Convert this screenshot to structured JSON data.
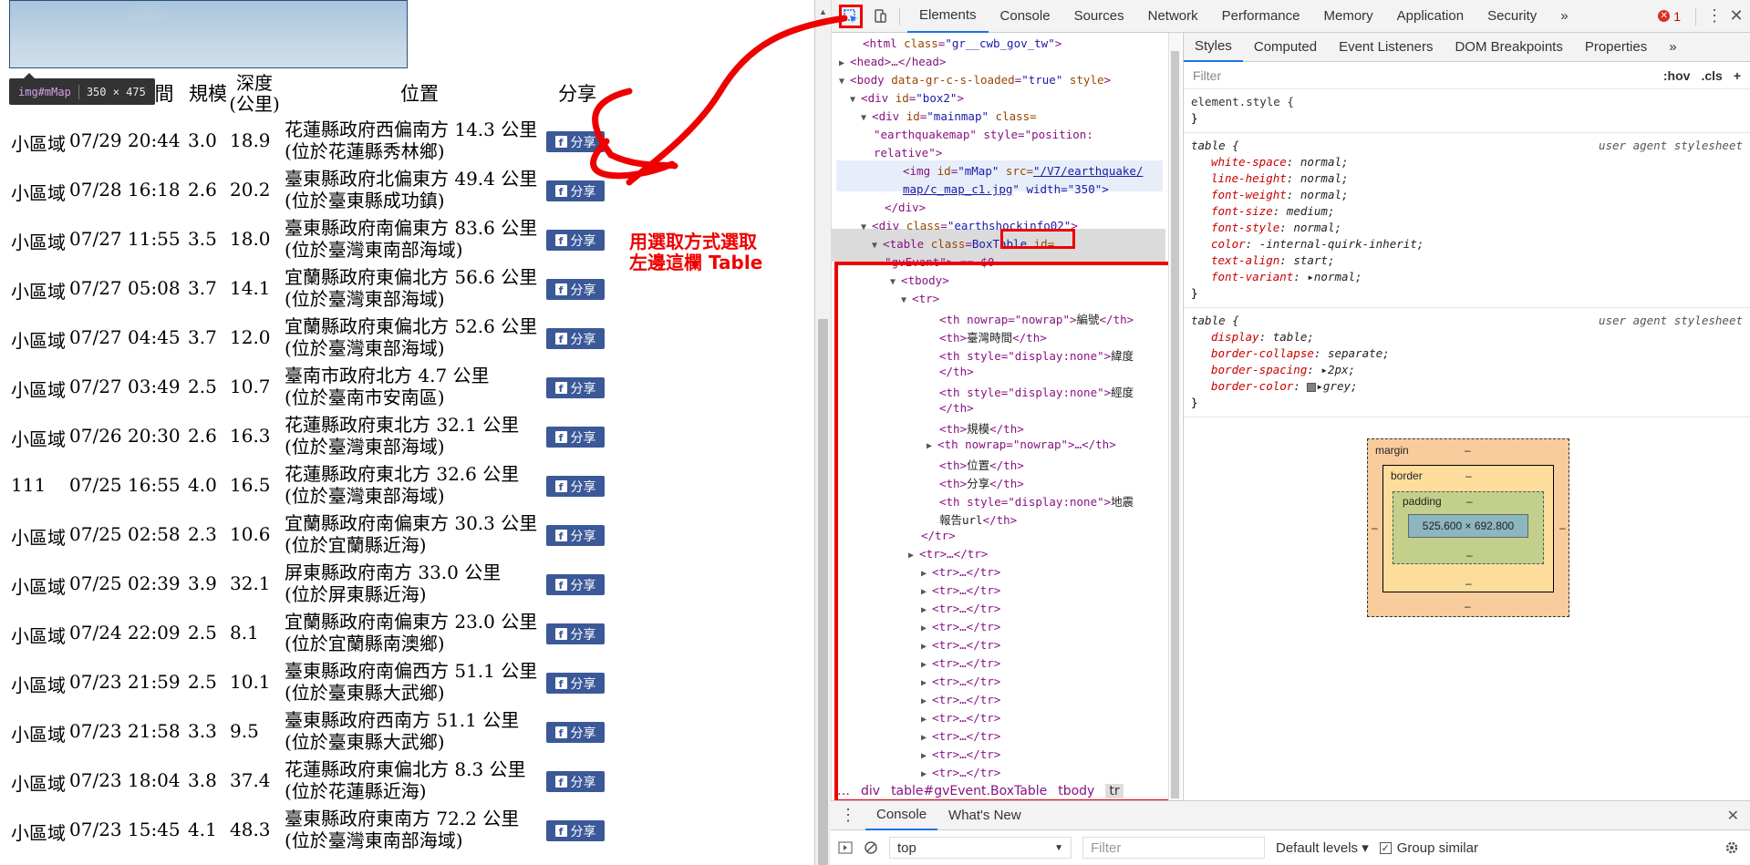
{
  "page": {
    "tooltip": {
      "tag": "img",
      "id": "#mMap",
      "size": "350 × 475"
    },
    "headers": {
      "time": "間",
      "magnitude": "規模",
      "depth_line1": "深度",
      "depth_line2": "(公里)",
      "location": "位置",
      "share": "分享"
    },
    "share_label": "分享",
    "fb_glyph": "f",
    "rows": [
      {
        "area": "小區域",
        "time": "07/29 20:44",
        "mag": "3.0",
        "depth": "18.9",
        "loc1": "花蓮縣政府西偏南方 14.3 公里",
        "loc2": "(位於花蓮縣秀林鄉)"
      },
      {
        "area": "小區域",
        "time": "07/28 16:18",
        "mag": "2.6",
        "depth": "20.2",
        "loc1": "臺東縣政府北偏東方 49.4 公里",
        "loc2": "(位於臺東縣成功鎮)"
      },
      {
        "area": "小區域",
        "time": "07/27 11:55",
        "mag": "3.5",
        "depth": "18.0",
        "loc1": "臺東縣政府南偏東方 83.6 公里",
        "loc2": "(位於臺灣東南部海域)"
      },
      {
        "area": "小區域",
        "time": "07/27 05:08",
        "mag": "3.7",
        "depth": "14.1",
        "loc1": "宜蘭縣政府東偏北方 56.6 公里",
        "loc2": "(位於臺灣東部海域)"
      },
      {
        "area": "小區域",
        "time": "07/27 04:45",
        "mag": "3.7",
        "depth": "12.0",
        "loc1": "宜蘭縣政府東偏北方 52.6 公里",
        "loc2": "(位於臺灣東部海域)"
      },
      {
        "area": "小區域",
        "time": "07/27 03:49",
        "mag": "2.5",
        "depth": "10.7",
        "loc1": "臺南市政府北方 4.7 公里",
        "loc2": "(位於臺南市安南區)"
      },
      {
        "area": "小區域",
        "time": "07/26 20:30",
        "mag": "2.6",
        "depth": "16.3",
        "loc1": "花蓮縣政府東北方 32.1 公里",
        "loc2": "(位於臺灣東部海域)"
      },
      {
        "area": "111",
        "time": "07/25 16:55",
        "mag": "4.0",
        "depth": "16.5",
        "loc1": "花蓮縣政府東北方 32.6 公里",
        "loc2": "(位於臺灣東部海域)"
      },
      {
        "area": "小區域",
        "time": "07/25 02:58",
        "mag": "2.3",
        "depth": "10.6",
        "loc1": "宜蘭縣政府南偏東方 30.3 公里",
        "loc2": "(位於宜蘭縣近海)"
      },
      {
        "area": "小區域",
        "time": "07/25 02:39",
        "mag": "3.9",
        "depth": "32.1",
        "loc1": "屏東縣政府南方 33.0 公里",
        "loc2": "(位於屏東縣近海)"
      },
      {
        "area": "小區域",
        "time": "07/24 22:09",
        "mag": "2.5",
        "depth": "8.1",
        "loc1": "宜蘭縣政府南偏東方 23.0 公里",
        "loc2": "(位於宜蘭縣南澳鄉)"
      },
      {
        "area": "小區域",
        "time": "07/23 21:59",
        "mag": "2.5",
        "depth": "10.1",
        "loc1": "臺東縣政府南偏西方 51.1 公里",
        "loc2": "(位於臺東縣大武鄉)"
      },
      {
        "area": "小區域",
        "time": "07/23 21:58",
        "mag": "3.3",
        "depth": "9.5",
        "loc1": "臺東縣政府西南方 51.1 公里",
        "loc2": "(位於臺東縣大武鄉)"
      },
      {
        "area": "小區域",
        "time": "07/23 18:04",
        "mag": "3.8",
        "depth": "37.4",
        "loc1": "花蓮縣政府東偏北方 8.3 公里",
        "loc2": "(位於花蓮縣近海)"
      },
      {
        "area": "小區域",
        "time": "07/23 15:45",
        "mag": "4.1",
        "depth": "48.3",
        "loc1": "臺東縣政府東南方 72.2 公里",
        "loc2": "(位於臺灣東南部海域)"
      }
    ],
    "annotation": {
      "line1": "用選取方式選取",
      "line2": "左邊這欄 Table"
    }
  },
  "devtools": {
    "tabs": [
      "Elements",
      "Console",
      "Sources",
      "Network",
      "Performance",
      "Memory",
      "Application",
      "Security"
    ],
    "more_tabs": "»",
    "error_count": "1",
    "kebab": "⋮",
    "close": "✕",
    "tree": [
      {
        "text_tag": "<html ",
        "a": "class",
        "v": "\"gr__cwb_gov_tw\"",
        "end": ">"
      },
      {
        "text": "<head>…</head>"
      },
      {
        "text_tag": "<body ",
        "a": "data-gr-c-s-loaded",
        "v": "\"true\"",
        "a2": " style",
        "end": ">"
      },
      {
        "text_tag": "<div ",
        "a": "id",
        "v": "\"box2\"",
        "end": ">"
      },
      {
        "text_tag": "<div ",
        "a": "id",
        "v": "\"mainmap\"",
        "a2": " class=",
        "end": ""
      },
      {
        "text": "\"earthquakemap\" style=\"position:"
      },
      {
        "text": "relative\">"
      },
      {
        "text_tag": "<img ",
        "a": "id",
        "v": "\"mMap\"",
        "a2": " src=",
        "link": "\"/V7/earthquake/"
      },
      {
        "link": "map/c_map_c1.jpg",
        "tail": "\" width=\"350\">"
      },
      {
        "text": "</div>"
      },
      {
        "text_tag": "<div ",
        "a": "class",
        "v": "\"earthshockinfo02\"",
        "end": ">"
      },
      {
        "text_tag": "<table ",
        "a": "class",
        "v": "BoxTable",
        "a2": " id=",
        "end": ""
      },
      {
        "text": "\"gvEvent\"> == $0"
      },
      {
        "text": "<tbody>"
      },
      {
        "text": "<tr>"
      },
      {
        "th": "<th nowrap=\"nowrap\">",
        "t": "編號",
        "c": "</th>"
      },
      {
        "th": "<th>",
        "t": "臺灣時間",
        "c": "</th>"
      },
      {
        "th": "<th style=\"display:none\">",
        "t": "緯度",
        "c": ""
      },
      {
        "text": "</th>"
      },
      {
        "th": "<th style=\"display:none\">",
        "t": "經度",
        "c": ""
      },
      {
        "text": "</th>"
      },
      {
        "th": "<th>",
        "t": "規模",
        "c": "</th>"
      },
      {
        "text": "<th nowrap=\"nowrap\">…</th>"
      },
      {
        "th": "<th>",
        "t": "位置",
        "c": "</th>"
      },
      {
        "th": "<th>",
        "t": "分享",
        "c": "</th>"
      },
      {
        "th": "<th style=\"display:none\">",
        "t": "地震",
        "c": ""
      },
      {
        "th": "",
        "t": "報告url",
        "c": "</th>"
      },
      {
        "text": "</tr>"
      },
      {
        "text": "<tr>…</tr>"
      }
    ],
    "collapsed_tr": "<tr>…</tr>",
    "crumbs": [
      "…",
      "div",
      "table#gvEvent.BoxTable",
      "tbody",
      "tr"
    ],
    "styles_tabs": [
      "Styles",
      "Computed",
      "Event Listeners",
      "DOM Breakpoints",
      "Properties",
      "»"
    ],
    "filter_placeholder": "Filter",
    "hov": ":hov",
    "cls": ".cls",
    "plus": "+",
    "rule_element": {
      "selector": "element.style {",
      "close": "}"
    },
    "rule_table1": {
      "selector": "table {",
      "source": "user agent stylesheet",
      "props": [
        [
          "white-space",
          "normal;"
        ],
        [
          "line-height",
          "normal;"
        ],
        [
          "font-weight",
          "normal;"
        ],
        [
          "font-size",
          "medium;"
        ],
        [
          "font-style",
          "normal;"
        ],
        [
          "color",
          "-internal-quirk-inherit;"
        ],
        [
          "text-align",
          "start;"
        ],
        [
          "font-variant",
          "▸normal;"
        ]
      ]
    },
    "rule_table2": {
      "selector": "table {",
      "source": "user agent stylesheet",
      "props": [
        [
          "display",
          "table;"
        ],
        [
          "border-collapse",
          "separate;"
        ],
        [
          "border-spacing",
          "▸2px;"
        ],
        [
          "border-color",
          "▸grey;"
        ]
      ]
    },
    "boxmodel": {
      "margin": "margin",
      "border": "border",
      "padding": "padding",
      "content": "525.600 × 692.800",
      "dash": "–"
    },
    "drawer": {
      "tabs": [
        "Console",
        "What's New"
      ],
      "context": "top",
      "filter": "Filter",
      "levels": "Default levels ▾",
      "group": "Group similar"
    }
  }
}
